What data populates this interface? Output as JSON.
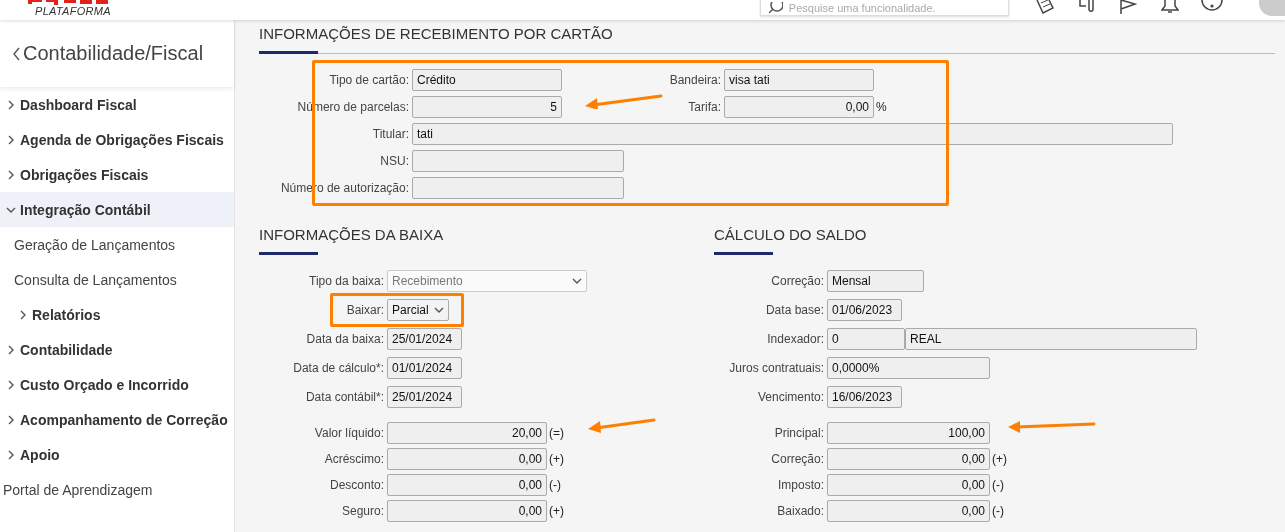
{
  "header": {
    "brand_subtitle": "PLATAFORMA",
    "search": {
      "placeholder": "Pesquise uma funcionalidade."
    }
  },
  "sidebar": {
    "title": "Contabilidade/Fiscal",
    "items": [
      {
        "label": "Dashboard Fiscal",
        "kind": "group",
        "expanded": false
      },
      {
        "label": "Agenda de Obrigações Fiscais",
        "kind": "group",
        "expanded": false
      },
      {
        "label": "Obrigações Fiscais",
        "kind": "group",
        "expanded": false
      },
      {
        "label": "Integração Contábil",
        "kind": "group",
        "expanded": true,
        "children": [
          {
            "label": "Geração de Lançamentos",
            "kind": "link"
          },
          {
            "label": "Consulta de Lançamentos",
            "kind": "link"
          },
          {
            "label": "Relatórios",
            "kind": "group",
            "expanded": false
          }
        ]
      },
      {
        "label": "Contabilidade",
        "kind": "group",
        "expanded": false
      },
      {
        "label": "Custo Orçado e Incorrido",
        "kind": "group",
        "expanded": false
      },
      {
        "label": "Acompanhamento de Correção",
        "kind": "group",
        "expanded": false
      },
      {
        "label": "Apoio",
        "kind": "group",
        "expanded": false
      },
      {
        "label": "Portal de Aprendizagem",
        "kind": "link"
      }
    ]
  },
  "card_section": {
    "title": "INFORMAÇÕES DE RECEBIMENTO POR CARTÃO",
    "rows": [
      {
        "fields": [
          {
            "label": "Tipo de cartão:",
            "kind": "text",
            "values": [
              "Crédito"
            ]
          },
          {
            "label": "Bandeira:",
            "kind": "text",
            "values": [
              "visa tati"
            ]
          }
        ]
      },
      {
        "fields": [
          {
            "label": "Número de parcelas:",
            "kind": "number",
            "values": [
              "5"
            ]
          },
          {
            "label": "Tarifa:",
            "kind": "number",
            "values": [
              "0,00"
            ],
            "suffix": "%"
          }
        ]
      },
      {
        "fields": [
          {
            "label": "Titular:",
            "kind": "text",
            "values": [
              "tati"
            ]
          }
        ]
      },
      {
        "fields": [
          {
            "label": "NSU:",
            "kind": "text"
          }
        ]
      },
      {
        "fields": [
          {
            "label": "Número de autorização:",
            "kind": "text"
          }
        ]
      }
    ]
  },
  "baixa_section": {
    "title": "INFORMAÇÕES DA BAIXA",
    "groups": [
      {
        "fields": [
          {
            "label": "Tipo da baixa:",
            "kind": "select",
            "disabled": true,
            "values": [
              "Recebimento"
            ]
          },
          {
            "label": "Baixar:",
            "kind": "select",
            "disabled": false,
            "values": [
              "Parcial"
            ]
          },
          {
            "label": "Data da baixa:",
            "kind": "text",
            "values": [
              "25/01/2024"
            ]
          },
          {
            "label": "Data de cálculo*:",
            "kind": "text",
            "values": [
              "01/01/2024"
            ]
          },
          {
            "label": "Data contábil*:",
            "kind": "text",
            "values": [
              "25/01/2024"
            ]
          }
        ]
      },
      {
        "fields": [
          {
            "label": "Valor líquido:",
            "kind": "number",
            "values": [
              "20,00"
            ],
            "suffix": "(=)"
          },
          {
            "label": "Acréscimo:",
            "kind": "number",
            "values": [
              "0,00"
            ],
            "suffix": "(+)"
          },
          {
            "label": "Desconto:",
            "kind": "number",
            "values": [
              "0,00"
            ],
            "suffix": "(-)"
          },
          {
            "label": "Seguro:",
            "kind": "number",
            "values": [
              "0,00"
            ],
            "suffix": "(+)"
          }
        ]
      }
    ]
  },
  "saldo_section": {
    "title": "CÁLCULO DO SALDO",
    "groups": [
      {
        "fields": [
          {
            "label": "Correção:",
            "kind": "text",
            "values": [
              "Mensal"
            ]
          },
          {
            "label": "Data base:",
            "kind": "text",
            "values": [
              "01/06/2023"
            ]
          },
          {
            "label": "Indexador:",
            "kind": "text",
            "values": [
              "0",
              "REAL"
            ]
          },
          {
            "label": "Juros contratuais:",
            "kind": "text",
            "values": [
              "0,0000%"
            ]
          },
          {
            "label": "Vencimento:",
            "kind": "text",
            "values": [
              "16/06/2023"
            ]
          }
        ]
      },
      {
        "fields": [
          {
            "label": "Principal:",
            "kind": "number",
            "values": [
              "100,00"
            ]
          },
          {
            "label": "Correção:",
            "kind": "number",
            "values": [
              "0,00"
            ],
            "suffix": "(+)"
          },
          {
            "label": "Imposto:",
            "kind": "number",
            "values": [
              "0,00"
            ],
            "suffix": "(-)"
          },
          {
            "label": "Baixado:",
            "kind": "number",
            "values": [
              "0,00"
            ],
            "suffix": "(-)"
          }
        ]
      }
    ]
  }
}
